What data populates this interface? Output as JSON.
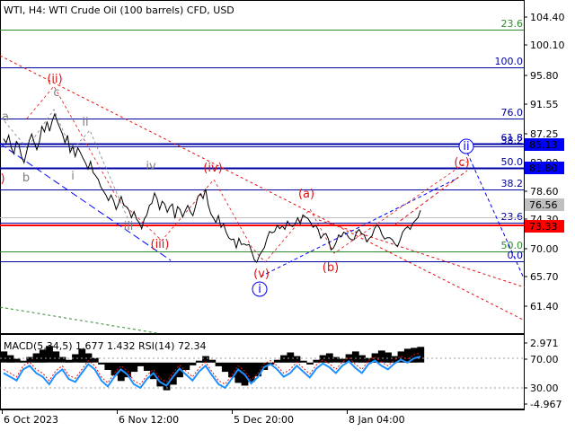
{
  "header": {
    "title": "WTI, H4:  WTI Crude Oil (100 barrels) CFD, USD"
  },
  "colors": {
    "red": "#ff0000",
    "blue": "#0000ff",
    "green": "#2e8b2e",
    "dark_blue": "#0000a0",
    "wave_red": "#e01010",
    "wave_gray": "#808080"
  },
  "chart_data": [
    {
      "type": "line",
      "title": "WTI, H4:  WTI Crude Oil (100 barrels) CFD, USD",
      "y_ticks": [
        "104.40",
        "100.10",
        "95.80",
        "91.55",
        "87.25",
        "82.90",
        "78.60",
        "74.30",
        "70.00",
        "65.70",
        "61.40"
      ],
      "x_ticks": [
        "6 Oct 2023",
        "6 Nov 12:00",
        "5 Dec 20:00",
        "8 Jan 04:00"
      ],
      "ylim": [
        58.5,
        107.0
      ],
      "price_tags": [
        {
          "label": "85.13",
          "value": 85.13,
          "color": "#0000ff"
        },
        {
          "label": "81.80",
          "value": 81.8,
          "color": "#0000ff"
        },
        {
          "label": "76.56",
          "value": 76.56,
          "color": "#c0c0c0"
        },
        {
          "label": "73.33",
          "value": 73.33,
          "color": "#ff0000"
        }
      ],
      "fib_levels": [
        {
          "label": "23.6",
          "value": 102.4,
          "color": "#2e8b2e"
        },
        {
          "label": "100.0",
          "value": 94.8,
          "color": "#0000a0"
        },
        {
          "label": "76.0",
          "value": 88.4,
          "color": "#0000a0"
        },
        {
          "label": "61.8",
          "value": 85.4,
          "color": "#0000a0"
        },
        {
          "label": "38.2",
          "value": 84.7,
          "color": "#0000a0"
        },
        {
          "label": "50.0",
          "value": 82.5,
          "color": "#0000a0"
        },
        {
          "label": "38.2",
          "value": 79.3,
          "color": "#0000a0"
        },
        {
          "label": "23.6",
          "value": 75.4,
          "color": "#0000a0"
        },
        {
          "label": "50.0",
          "value": 70.8,
          "color": "#2e8b2e"
        },
        {
          "label": "0.0",
          "value": 69.6,
          "color": "#0000a0"
        }
      ],
      "wave_labels": [
        {
          "label": "(ii)",
          "color": "#e01010"
        },
        {
          "label": "c",
          "color": "#808080"
        },
        {
          "label": "a",
          "color": "#808080"
        },
        {
          "label": "ii",
          "color": "#808080"
        },
        {
          "label": "b",
          "color": "#808080"
        },
        {
          "label": "i",
          "color": "#808080"
        },
        {
          "label": "iv",
          "color": "#808080"
        },
        {
          "label": "(iv)",
          "color": "#e01010"
        },
        {
          "label": "iii",
          "color": "#808080"
        },
        {
          "label": "(iii)",
          "color": "#e01010"
        },
        {
          "label": "(a)",
          "color": "#e01010"
        },
        {
          "label": "(v)",
          "color": "#e01010"
        },
        {
          "label": "(b)",
          "color": "#e01010"
        },
        {
          "label": "(c)",
          "color": "#e01010"
        },
        {
          "label": ")",
          "color": "#e01010"
        },
        {
          "label": "i",
          "color": "#0000ff",
          "circled": true
        },
        {
          "label": "ii",
          "color": "#0000ff",
          "circled": true
        }
      ],
      "series": [
        {
          "values": [
            86.8,
            86.2,
            87.3,
            85.5,
            84.6,
            86.4,
            85.9,
            84.2,
            83.3,
            84.9,
            86.5,
            87.5,
            86.2,
            85.2,
            86.4,
            88.6,
            87.8,
            89.3,
            87.9,
            89.4,
            90.4,
            89.3,
            88.4,
            87.5,
            86.2,
            87.3,
            84.8,
            85.7,
            84.2,
            85.5,
            84.8,
            84.0,
            83.3,
            82.4,
            83.5,
            81.9,
            81.4,
            80.9,
            79.8,
            79.2,
            78.6,
            77.8,
            78.6,
            77.8,
            76.5,
            77.4,
            78.4,
            77.1,
            76.9,
            76.4,
            75.3,
            76.2,
            75.1,
            74.6,
            73.7,
            75.1,
            75.7,
            77.1,
            77.4,
            78.9,
            78.1,
            76.5,
            77.7,
            77.3,
            76.1,
            76.9,
            77.3,
            75.2,
            76.9,
            76.5,
            75.4,
            76.3,
            77.1,
            76.2,
            75.6,
            76.9,
            78.4,
            78.8,
            78.1,
            79.5,
            77.2,
            75.9,
            75.3,
            74.6,
            75.6,
            73.9,
            74.4,
            73.2,
            72.4,
            72.1,
            72.2,
            70.9,
            72.3,
            71.4,
            71.5,
            71.3,
            71.4,
            70.4,
            69.2,
            68.8,
            69.8,
            70.4,
            71.0,
            72.3,
            73.3,
            73.1,
            73.3,
            74.2,
            73.7,
            74.1,
            73.6,
            74.8,
            74.2,
            74.0,
            74.4,
            75.3,
            74.4,
            75.7,
            75.4,
            75.2,
            74.6,
            73.9,
            74.2,
            73.6,
            72.3,
            72.8,
            73.0,
            72.2,
            70.6,
            70.9,
            71.7,
            72.8,
            72.5,
            73.2,
            73.0,
            72.4,
            72.1,
            72.1,
            73.2,
            73.6,
            73.0,
            72.8,
            71.8,
            72.3,
            72.6,
            73.7,
            74.3,
            73.8,
            72.8,
            72.2,
            72.4,
            72.4,
            72.1,
            71.5,
            71.1,
            72.0,
            73.2,
            73.7,
            74.0,
            73.6,
            74.5,
            74.9,
            75.3,
            76.4
          ]
        }
      ]
    },
    {
      "type": "line",
      "title": "MACD(5,34,5) 1.677 1.432 RSI(14) 72.34",
      "y_ticks": [
        "2.971",
        "70.00",
        "30.00",
        "-4.967"
      ],
      "ylim": [
        -5.0,
        3.0
      ],
      "levels": [
        70.0,
        30.0
      ],
      "series": [
        {
          "name": "MACD(5,34,5)",
          "values": [
            1.2,
            0.8,
            0.4,
            0.2,
            0.6,
            1.0,
            1.4,
            1.8,
            1.2,
            0.6,
            0.3,
            0.9,
            1.5,
            1.0,
            0.5,
            -0.2,
            -0.8,
            -1.4,
            -2.0,
            -1.6,
            -1.0,
            -0.4,
            -0.9,
            -1.8,
            -2.6,
            -3.0,
            -2.4,
            -1.6,
            -0.8,
            -0.3,
            0.2,
            0.7,
            0.3,
            -0.4,
            -1.0,
            -1.6,
            -2.2,
            -2.5,
            -2.1,
            -1.5,
            -0.8,
            -0.2,
            0.3,
            0.8,
            1.1,
            0.7,
            0.2,
            -0.2,
            0.3,
            0.8,
            1.0,
            0.6,
            0.4,
            0.9,
            1.2,
            0.8,
            0.5,
            1.0,
            1.3,
            1.1,
            0.7,
            1.2,
            1.5,
            1.6,
            1.7
          ]
        },
        {
          "name": "RSI(14)",
          "values": [
            50,
            45,
            40,
            55,
            60,
            50,
            45,
            35,
            48,
            55,
            42,
            38,
            50,
            62,
            55,
            40,
            32,
            45,
            55,
            48,
            35,
            30,
            42,
            50,
            38,
            33,
            45,
            56,
            48,
            40,
            52,
            60,
            47,
            35,
            30,
            42,
            55,
            48,
            36,
            44,
            58,
            62,
            55,
            45,
            50,
            60,
            52,
            44,
            56,
            63,
            58,
            50,
            60,
            66,
            57,
            50,
            62,
            67,
            60,
            55,
            63,
            68,
            64,
            70,
            72.34
          ]
        }
      ]
    }
  ]
}
